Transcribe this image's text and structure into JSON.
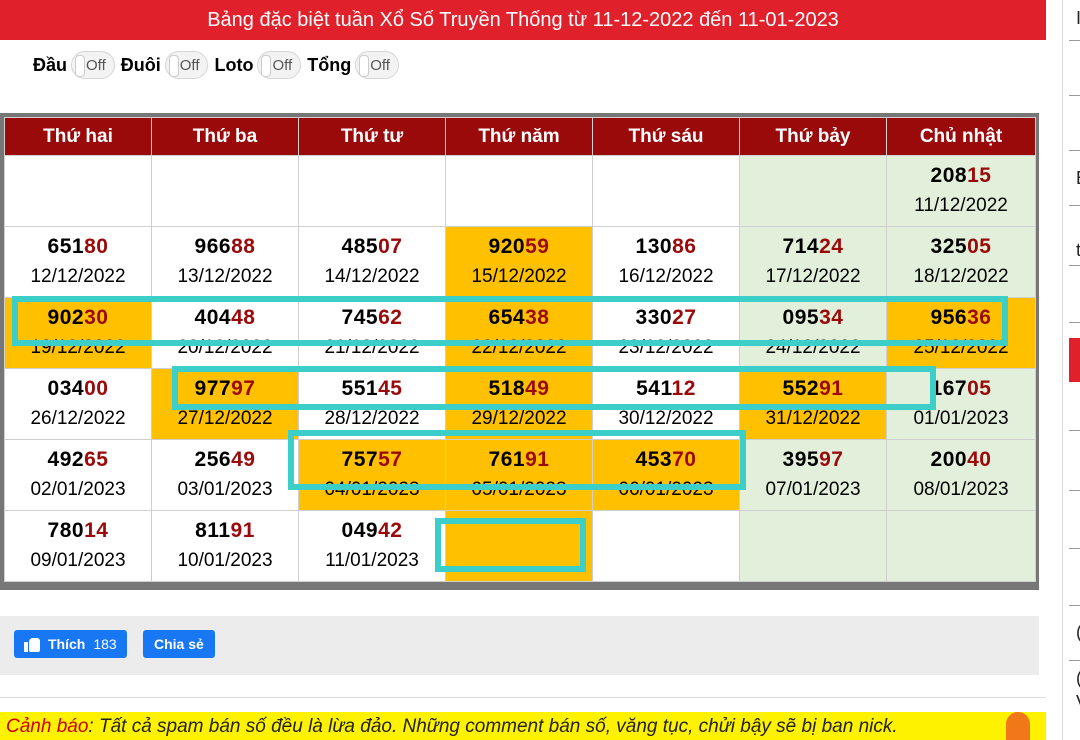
{
  "header": {
    "title": "Bảng đặc biệt tuần Xổ Số Truyền Thống từ 11-12-2022 đến 11-01-2023"
  },
  "toggles": [
    {
      "label": "Đầu",
      "state": "Off"
    },
    {
      "label": "Đuôi",
      "state": "Off"
    },
    {
      "label": "Loto",
      "state": "Off"
    },
    {
      "label": "Tổng",
      "state": "Off"
    }
  ],
  "table": {
    "columns": [
      "Thứ hai",
      "Thứ ba",
      "Thứ tư",
      "Thứ năm",
      "Thứ sáu",
      "Thứ bảy",
      "Chủ nhật"
    ],
    "rows": [
      [
        {
          "head": "",
          "tail": "",
          "date": ""
        },
        {
          "head": "",
          "tail": "",
          "date": ""
        },
        {
          "head": "",
          "tail": "",
          "date": ""
        },
        {
          "head": "",
          "tail": "",
          "date": ""
        },
        {
          "head": "",
          "tail": "",
          "date": ""
        },
        {
          "head": "",
          "tail": "",
          "date": ""
        },
        {
          "head": "208",
          "tail": "15",
          "date": "11/12/2022"
        }
      ],
      [
        {
          "head": "651",
          "tail": "80",
          "date": "12/12/2022"
        },
        {
          "head": "966",
          "tail": "88",
          "date": "13/12/2022"
        },
        {
          "head": "485",
          "tail": "07",
          "date": "14/12/2022"
        },
        {
          "head": "920",
          "tail": "59",
          "date": "15/12/2022",
          "hl": true
        },
        {
          "head": "130",
          "tail": "86",
          "date": "16/12/2022"
        },
        {
          "head": "714",
          "tail": "24",
          "date": "17/12/2022"
        },
        {
          "head": "325",
          "tail": "05",
          "date": "18/12/2022"
        }
      ],
      [
        {
          "head": "902",
          "tail": "30",
          "date": "19/12/2022",
          "hl": true
        },
        {
          "head": "404",
          "tail": "48",
          "date": "20/12/2022"
        },
        {
          "head": "745",
          "tail": "62",
          "date": "21/12/2022"
        },
        {
          "head": "654",
          "tail": "38",
          "date": "22/12/2022",
          "hl": true
        },
        {
          "head": "330",
          "tail": "27",
          "date": "23/12/2022"
        },
        {
          "head": "095",
          "tail": "34",
          "date": "24/12/2022"
        },
        {
          "head": "956",
          "tail": "36",
          "date": "25/12/2022",
          "hl": true
        }
      ],
      [
        {
          "head": "034",
          "tail": "00",
          "date": "26/12/2022"
        },
        {
          "head": "977",
          "tail": "97",
          "date": "27/12/2022",
          "hl": true
        },
        {
          "head": "551",
          "tail": "45",
          "date": "28/12/2022"
        },
        {
          "head": "518",
          "tail": "49",
          "date": "29/12/2022",
          "hl": true
        },
        {
          "head": "541",
          "tail": "12",
          "date": "30/12/2022"
        },
        {
          "head": "552",
          "tail": "91",
          "date": "31/12/2022",
          "hl": true
        },
        {
          "head": "167",
          "tail": "05",
          "date": "01/01/2023"
        }
      ],
      [
        {
          "head": "492",
          "tail": "65",
          "date": "02/01/2023"
        },
        {
          "head": "256",
          "tail": "49",
          "date": "03/01/2023"
        },
        {
          "head": "757",
          "tail": "57",
          "date": "04/01/2023",
          "hl": true
        },
        {
          "head": "761",
          "tail": "91",
          "date": "05/01/2023",
          "hl": true
        },
        {
          "head": "453",
          "tail": "70",
          "date": "06/01/2023",
          "hl": true
        },
        {
          "head": "395",
          "tail": "97",
          "date": "07/01/2023"
        },
        {
          "head": "200",
          "tail": "40",
          "date": "08/01/2023"
        }
      ],
      [
        {
          "head": "780",
          "tail": "14",
          "date": "09/01/2023"
        },
        {
          "head": "811",
          "tail": "91",
          "date": "10/01/2023"
        },
        {
          "head": "049",
          "tail": "42",
          "date": "11/01/2023"
        },
        {
          "head": "",
          "tail": "",
          "date": "",
          "hl": true
        },
        {
          "head": "",
          "tail": "",
          "date": ""
        },
        {
          "head": "",
          "tail": "",
          "date": ""
        },
        {
          "head": "",
          "tail": "",
          "date": ""
        }
      ]
    ]
  },
  "social": {
    "like_label": "Thích",
    "like_count": "183",
    "share_label": "Chia sẻ"
  },
  "warning": {
    "label": "Cảnh báo",
    "text": ": Tất cả spam bán số đều là lừa đảo. Những comment bán số, văng tục, chửi bậy sẽ bị ban nick."
  },
  "right_panel": {
    "chars": [
      "I",
      "E",
      "t",
      "(",
      "(",
      "V"
    ]
  },
  "colors": {
    "header_red": "#e0202a",
    "column_header": "#9b0a0a",
    "highlight": "#ffc000",
    "weekend": "#e2efda",
    "annotation_box": "#3ccfc9",
    "warning_bg": "#fff200"
  }
}
